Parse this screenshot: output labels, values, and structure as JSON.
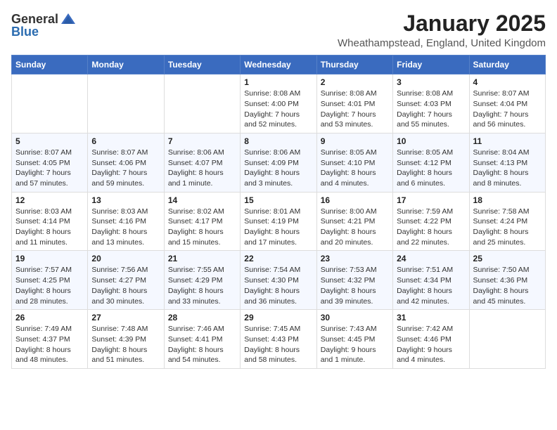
{
  "header": {
    "logo_general": "General",
    "logo_blue": "Blue",
    "month": "January 2025",
    "location": "Wheathampstead, England, United Kingdom"
  },
  "weekdays": [
    "Sunday",
    "Monday",
    "Tuesday",
    "Wednesday",
    "Thursday",
    "Friday",
    "Saturday"
  ],
  "weeks": [
    [
      {
        "day": "",
        "info": ""
      },
      {
        "day": "",
        "info": ""
      },
      {
        "day": "",
        "info": ""
      },
      {
        "day": "1",
        "info": "Sunrise: 8:08 AM\nSunset: 4:00 PM\nDaylight: 7 hours\nand 52 minutes."
      },
      {
        "day": "2",
        "info": "Sunrise: 8:08 AM\nSunset: 4:01 PM\nDaylight: 7 hours\nand 53 minutes."
      },
      {
        "day": "3",
        "info": "Sunrise: 8:08 AM\nSunset: 4:03 PM\nDaylight: 7 hours\nand 55 minutes."
      },
      {
        "day": "4",
        "info": "Sunrise: 8:07 AM\nSunset: 4:04 PM\nDaylight: 7 hours\nand 56 minutes."
      }
    ],
    [
      {
        "day": "5",
        "info": "Sunrise: 8:07 AM\nSunset: 4:05 PM\nDaylight: 7 hours\nand 57 minutes."
      },
      {
        "day": "6",
        "info": "Sunrise: 8:07 AM\nSunset: 4:06 PM\nDaylight: 7 hours\nand 59 minutes."
      },
      {
        "day": "7",
        "info": "Sunrise: 8:06 AM\nSunset: 4:07 PM\nDaylight: 8 hours\nand 1 minute."
      },
      {
        "day": "8",
        "info": "Sunrise: 8:06 AM\nSunset: 4:09 PM\nDaylight: 8 hours\nand 3 minutes."
      },
      {
        "day": "9",
        "info": "Sunrise: 8:05 AM\nSunset: 4:10 PM\nDaylight: 8 hours\nand 4 minutes."
      },
      {
        "day": "10",
        "info": "Sunrise: 8:05 AM\nSunset: 4:12 PM\nDaylight: 8 hours\nand 6 minutes."
      },
      {
        "day": "11",
        "info": "Sunrise: 8:04 AM\nSunset: 4:13 PM\nDaylight: 8 hours\nand 8 minutes."
      }
    ],
    [
      {
        "day": "12",
        "info": "Sunrise: 8:03 AM\nSunset: 4:14 PM\nDaylight: 8 hours\nand 11 minutes."
      },
      {
        "day": "13",
        "info": "Sunrise: 8:03 AM\nSunset: 4:16 PM\nDaylight: 8 hours\nand 13 minutes."
      },
      {
        "day": "14",
        "info": "Sunrise: 8:02 AM\nSunset: 4:17 PM\nDaylight: 8 hours\nand 15 minutes."
      },
      {
        "day": "15",
        "info": "Sunrise: 8:01 AM\nSunset: 4:19 PM\nDaylight: 8 hours\nand 17 minutes."
      },
      {
        "day": "16",
        "info": "Sunrise: 8:00 AM\nSunset: 4:21 PM\nDaylight: 8 hours\nand 20 minutes."
      },
      {
        "day": "17",
        "info": "Sunrise: 7:59 AM\nSunset: 4:22 PM\nDaylight: 8 hours\nand 22 minutes."
      },
      {
        "day": "18",
        "info": "Sunrise: 7:58 AM\nSunset: 4:24 PM\nDaylight: 8 hours\nand 25 minutes."
      }
    ],
    [
      {
        "day": "19",
        "info": "Sunrise: 7:57 AM\nSunset: 4:25 PM\nDaylight: 8 hours\nand 28 minutes."
      },
      {
        "day": "20",
        "info": "Sunrise: 7:56 AM\nSunset: 4:27 PM\nDaylight: 8 hours\nand 30 minutes."
      },
      {
        "day": "21",
        "info": "Sunrise: 7:55 AM\nSunset: 4:29 PM\nDaylight: 8 hours\nand 33 minutes."
      },
      {
        "day": "22",
        "info": "Sunrise: 7:54 AM\nSunset: 4:30 PM\nDaylight: 8 hours\nand 36 minutes."
      },
      {
        "day": "23",
        "info": "Sunrise: 7:53 AM\nSunset: 4:32 PM\nDaylight: 8 hours\nand 39 minutes."
      },
      {
        "day": "24",
        "info": "Sunrise: 7:51 AM\nSunset: 4:34 PM\nDaylight: 8 hours\nand 42 minutes."
      },
      {
        "day": "25",
        "info": "Sunrise: 7:50 AM\nSunset: 4:36 PM\nDaylight: 8 hours\nand 45 minutes."
      }
    ],
    [
      {
        "day": "26",
        "info": "Sunrise: 7:49 AM\nSunset: 4:37 PM\nDaylight: 8 hours\nand 48 minutes."
      },
      {
        "day": "27",
        "info": "Sunrise: 7:48 AM\nSunset: 4:39 PM\nDaylight: 8 hours\nand 51 minutes."
      },
      {
        "day": "28",
        "info": "Sunrise: 7:46 AM\nSunset: 4:41 PM\nDaylight: 8 hours\nand 54 minutes."
      },
      {
        "day": "29",
        "info": "Sunrise: 7:45 AM\nSunset: 4:43 PM\nDaylight: 8 hours\nand 58 minutes."
      },
      {
        "day": "30",
        "info": "Sunrise: 7:43 AM\nSunset: 4:45 PM\nDaylight: 9 hours\nand 1 minute."
      },
      {
        "day": "31",
        "info": "Sunrise: 7:42 AM\nSunset: 4:46 PM\nDaylight: 9 hours\nand 4 minutes."
      },
      {
        "day": "",
        "info": ""
      }
    ]
  ]
}
